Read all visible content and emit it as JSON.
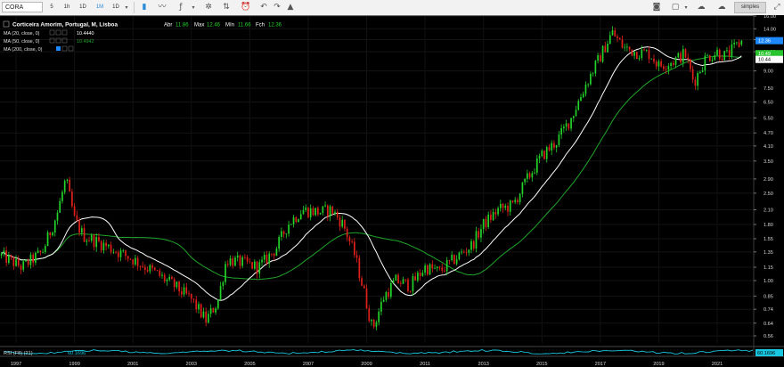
{
  "toolbar": {
    "symbol": "CORA",
    "intervals": [
      "5",
      "1h",
      "1D",
      "1M",
      "1D"
    ],
    "active_interval": "1M",
    "style_label": "simples"
  },
  "legend": {
    "title": "Corticeira Amorim, Portugal, M, Lisboa",
    "open_label": "Abr",
    "open": "11.86",
    "high_label": "Max",
    "high": "12.46",
    "low_label": "Mín",
    "low": "11.66",
    "close_label": "Fch",
    "close": "12.36",
    "ma20_label": "MA (20, close, 0)",
    "ma20_value": "10.4440",
    "ma50_label": "MA (50, close, 0)",
    "ma50_value": "10.4942",
    "ma200_label": "MA (200, close, 0)"
  },
  "rsi": {
    "label": "RSI (F8) (21)",
    "value_left": "60.1696",
    "value_right": "60.1696"
  },
  "colors": {
    "up": "#22d32a",
    "down": "#e0201a",
    "ma20": "#ffffff",
    "ma50": "#1fa52a",
    "rsi": "#19c8e0",
    "price_tag": "#1e88ff",
    "ma50_tag": "#29c52f"
  },
  "chart_data": {
    "type": "candlestick",
    "title": "Corticeira Amorim, Portugal, M, Lisboa",
    "y_scale": "log",
    "ylim": [
      0.52,
      16.0
    ],
    "y_ticks": [
      "16.00",
      "14.00",
      "12.50",
      "11.00",
      "9.00",
      "7.50",
      "6.50",
      "5.50",
      "4.70",
      "4.10",
      "3.50",
      "2.90",
      "2.50",
      "2.10",
      "1.80",
      "1.55",
      "1.35",
      "1.15",
      "1.00",
      "0.85",
      "0.74",
      "0.64",
      "0.56"
    ],
    "x_ticks": [
      "1997",
      "1999",
      "2001",
      "2003",
      "2005",
      "2007",
      "2009",
      "2011",
      "2013",
      "2015",
      "2017",
      "2019",
      "2021"
    ],
    "last_close": "12.36",
    "axis_tags": [
      {
        "text": "12.36",
        "value": 12.36,
        "color": "#1e88ff"
      },
      {
        "text": "10.49",
        "value": 10.49,
        "color": "#29c52f"
      },
      {
        "text": "10.44",
        "value": 10.44,
        "color": "#ffffff"
      }
    ],
    "anchors": [
      [
        1996.5,
        1.3
      ],
      [
        1997.2,
        1.15
      ],
      [
        1997.9,
        1.35
      ],
      [
        1998.4,
        2.0
      ],
      [
        1998.7,
        2.9
      ],
      [
        1999.0,
        1.9
      ],
      [
        1999.3,
        1.6
      ],
      [
        1999.8,
        1.5
      ],
      [
        2000.5,
        1.35
      ],
      [
        2001.0,
        1.25
      ],
      [
        2001.7,
        1.1
      ],
      [
        2002.4,
        0.95
      ],
      [
        2003.0,
        0.82
      ],
      [
        2003.5,
        0.66
      ],
      [
        2003.9,
        0.8
      ],
      [
        2004.2,
        1.25
      ],
      [
        2004.8,
        1.2
      ],
      [
        2005.3,
        1.15
      ],
      [
        2005.9,
        1.4
      ],
      [
        2006.3,
        1.8
      ],
      [
        2006.8,
        2.1
      ],
      [
        2007.4,
        2.05
      ],
      [
        2007.8,
        2.1
      ],
      [
        2008.2,
        1.8
      ],
      [
        2008.6,
        1.3
      ],
      [
        2008.9,
        0.9
      ],
      [
        2009.2,
        0.6
      ],
      [
        2009.6,
        0.85
      ],
      [
        2010.0,
        1.0
      ],
      [
        2010.5,
        0.95
      ],
      [
        2011.0,
        1.15
      ],
      [
        2011.5,
        1.1
      ],
      [
        2012.0,
        1.25
      ],
      [
        2012.6,
        1.45
      ],
      [
        2013.0,
        1.8
      ],
      [
        2013.5,
        2.1
      ],
      [
        2014.0,
        2.2
      ],
      [
        2014.5,
        2.9
      ],
      [
        2015.0,
        3.7
      ],
      [
        2015.5,
        4.3
      ],
      [
        2016.0,
        5.5
      ],
      [
        2016.5,
        7.8
      ],
      [
        2017.0,
        10.5
      ],
      [
        2017.4,
        13.5
      ],
      [
        2017.8,
        11.5
      ],
      [
        2018.2,
        11.0
      ],
      [
        2018.7,
        10.8
      ],
      [
        2019.0,
        9.5
      ],
      [
        2019.5,
        10.0
      ],
      [
        2019.9,
        10.8
      ],
      [
        2020.2,
        8.0
      ],
      [
        2020.6,
        10.3
      ],
      [
        2021.0,
        11.0
      ],
      [
        2021.3,
        10.5
      ],
      [
        2021.6,
        11.5
      ],
      [
        2021.9,
        12.36
      ]
    ],
    "rsi_value": 60.1696
  }
}
